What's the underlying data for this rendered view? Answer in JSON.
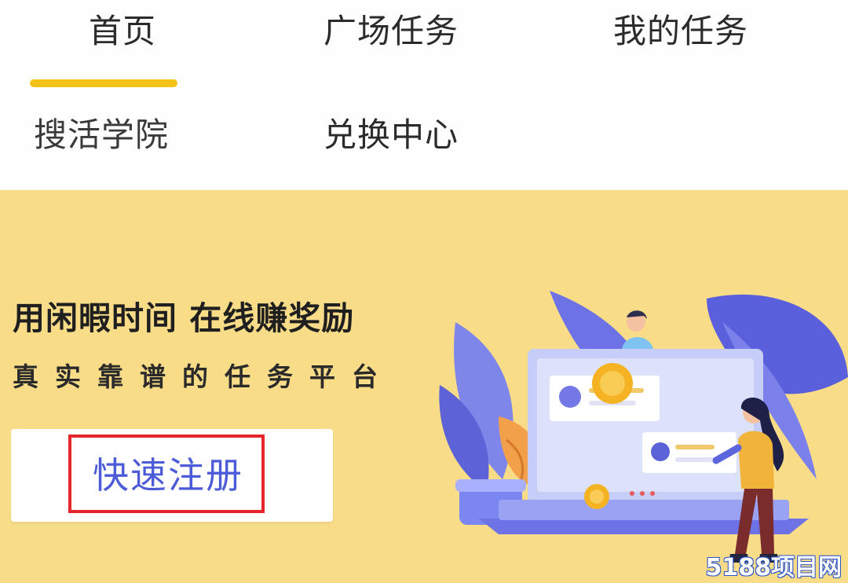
{
  "nav": {
    "tabs": [
      {
        "label": "首页",
        "active": true
      },
      {
        "label": "广场任务"
      },
      {
        "label": "我的任务"
      },
      {
        "label": "搜活学院"
      },
      {
        "label": "兑换中心"
      }
    ],
    "active_color": "#f5c318"
  },
  "banner": {
    "headline": "用闲暇时间 在线赚奖励",
    "subline": "真实靠谱的任务平台",
    "register_button": "快速注册",
    "background_color": "#f8dc88",
    "highlight_color": "#e4252b"
  },
  "watermark": "5188项目网"
}
